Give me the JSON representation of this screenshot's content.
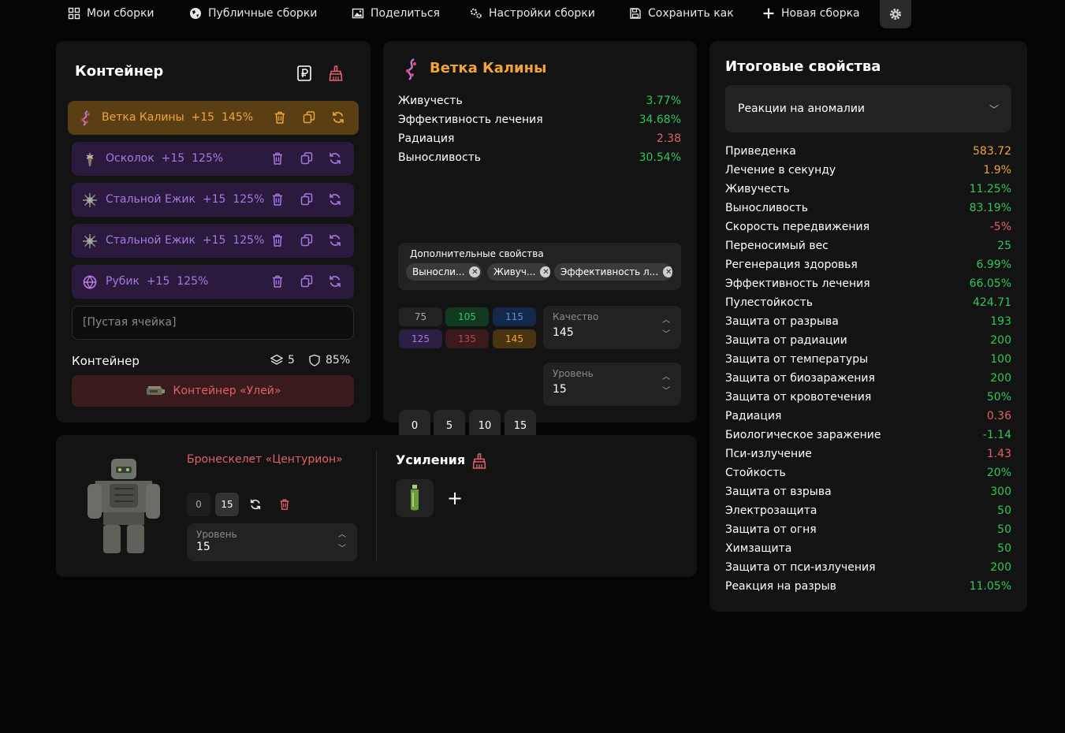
{
  "nav": {
    "my_builds": "Мои сборки",
    "public_builds": "Публичные сборки",
    "share": "Поделиться",
    "build_settings": "Настройки сборки",
    "save_as": "Сохранить как",
    "new_build": "Новая сборка"
  },
  "container": {
    "title": "Контейнер",
    "slots": [
      {
        "name": "Ветка Калины",
        "level": "+15",
        "quality": "145%"
      },
      {
        "name": "Осколок",
        "level": "+15",
        "quality": "125%"
      },
      {
        "name": "Стальной Ежик",
        "level": "+15",
        "quality": "125%"
      },
      {
        "name": "Стальной Ежик",
        "level": "+15",
        "quality": "125%"
      },
      {
        "name": "Рубик",
        "level": "+15",
        "quality": "125%"
      }
    ],
    "empty_slot": "[Пустая ячейка]",
    "footer_label": "Контейнер",
    "capacity": "5",
    "protection": "85%",
    "container_name": "Контейнер «Улей»"
  },
  "artifact": {
    "title": "Ветка Калины",
    "props": [
      {
        "label": "Живучесть",
        "value": "3.77%",
        "tone": "green"
      },
      {
        "label": "Эффективность лечения",
        "value": "34.68%",
        "tone": "green"
      },
      {
        "label": "Радиация",
        "value": "2.38",
        "tone": "red"
      },
      {
        "label": "Выносливость",
        "value": "30.54%",
        "tone": "green"
      }
    ],
    "extra_title": "Дополнительные свойства",
    "chips": [
      "Выносли...",
      "Живуч...",
      "Эффективность л..."
    ],
    "quality_options": [
      "75",
      "105",
      "115",
      "125",
      "135",
      "145"
    ],
    "quality_label": "Качество",
    "quality_value": "145",
    "level_options": [
      "0",
      "5",
      "10",
      "15"
    ],
    "level_label": "Уровень",
    "level_value": "15"
  },
  "armor": {
    "name": "Бронескелет «Центурион»",
    "levels": [
      "0",
      "15"
    ],
    "level_label": "Уровень",
    "level_value": "15",
    "boosts_title": "Усиления"
  },
  "totals": {
    "title": "Итоговые свойства",
    "category": "Реакции на аномалии",
    "rows": [
      {
        "label": "Приведенка",
        "value": "583.72",
        "tone": "orange"
      },
      {
        "label": "Лечение в секунду",
        "value": "1.9%",
        "tone": "orange"
      },
      {
        "label": "Живучесть",
        "value": "11.25%",
        "tone": "green"
      },
      {
        "label": "Выносливость",
        "value": "83.19%",
        "tone": "green"
      },
      {
        "label": "Скорость передвижения",
        "value": "-5%",
        "tone": "red"
      },
      {
        "label": "Переносимый вес",
        "value": "25",
        "tone": "green"
      },
      {
        "label": "Регенерация здоровья",
        "value": "6.99%",
        "tone": "green"
      },
      {
        "label": "Эффективность лечения",
        "value": "66.05%",
        "tone": "green"
      },
      {
        "label": "Пулестойкость",
        "value": "424.71",
        "tone": "green"
      },
      {
        "label": "Защита от разрыва",
        "value": "193",
        "tone": "green"
      },
      {
        "label": "Защита от радиации",
        "value": "200",
        "tone": "green"
      },
      {
        "label": "Защита от температуры",
        "value": "100",
        "tone": "green"
      },
      {
        "label": "Защита от биозаражения",
        "value": "200",
        "tone": "green"
      },
      {
        "label": "Защита от кровотечения",
        "value": "50%",
        "tone": "green"
      },
      {
        "label": "Радиация",
        "value": "0.36",
        "tone": "red"
      },
      {
        "label": "Биологическое заражение",
        "value": "-1.14",
        "tone": "green"
      },
      {
        "label": "Пси-излучение",
        "value": "1.43",
        "tone": "red"
      },
      {
        "label": "Стойкость",
        "value": "20%",
        "tone": "green"
      },
      {
        "label": "Защита от взрыва",
        "value": "300",
        "tone": "green"
      },
      {
        "label": "Электрозащита",
        "value": "50",
        "tone": "green"
      },
      {
        "label": "Защита от огня",
        "value": "50",
        "tone": "green"
      },
      {
        "label": "Химзащита",
        "value": "50",
        "tone": "green"
      },
      {
        "label": "Защита от пси-излучения",
        "value": "200",
        "tone": "green"
      },
      {
        "label": "Реакция на разрыв",
        "value": "11.05%",
        "tone": "green"
      }
    ]
  },
  "colors": {
    "bg": "#050505",
    "card": "#131313",
    "accent_orange": "#f0a53a",
    "accent_purple": "#a679e0",
    "positive": "#2fc75a",
    "negative": "#e0616a"
  }
}
